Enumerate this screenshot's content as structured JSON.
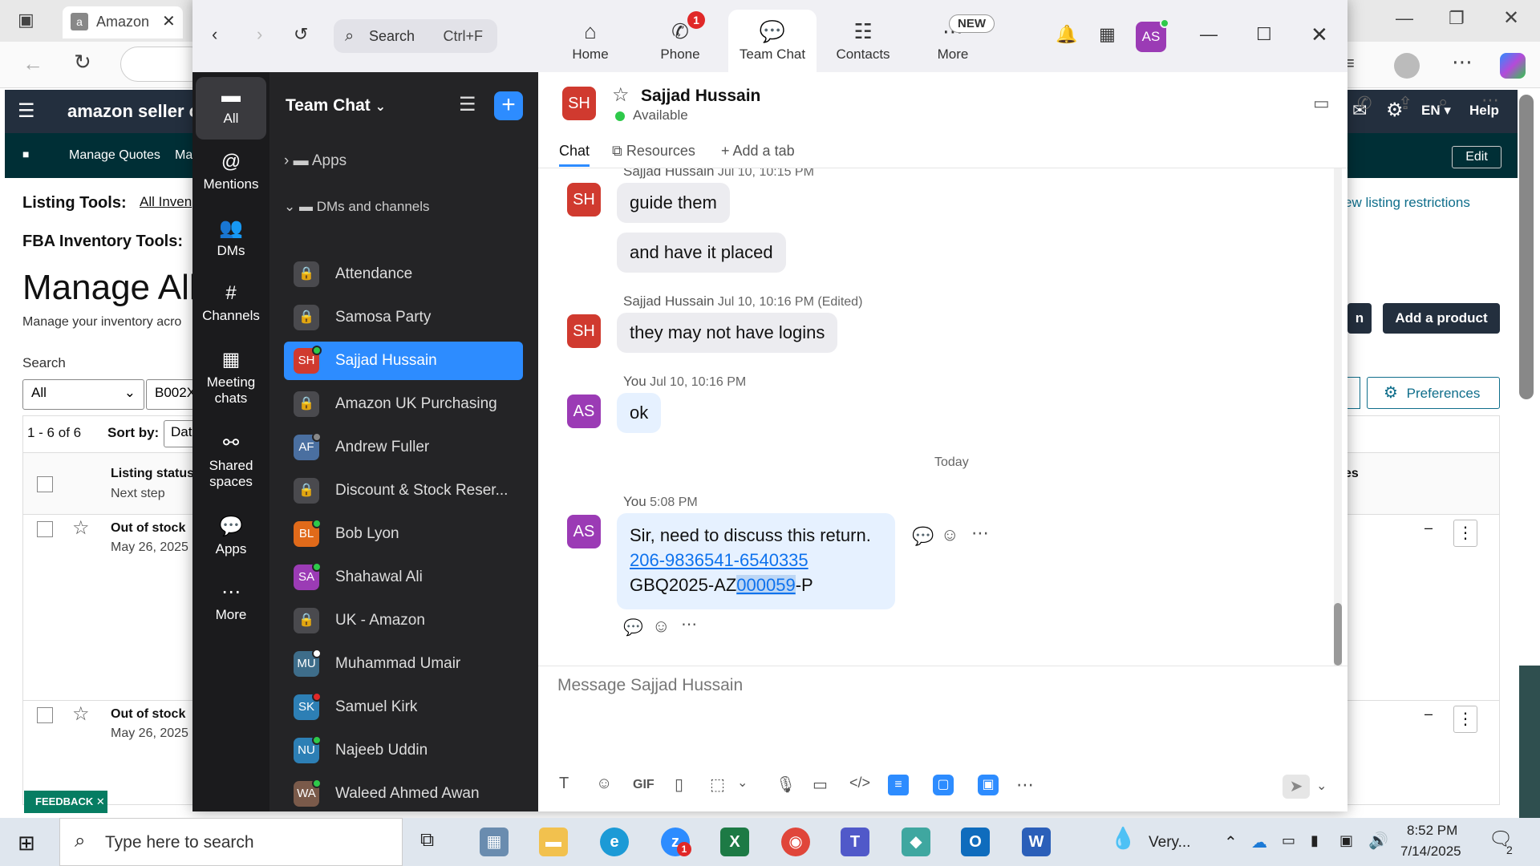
{
  "browser": {
    "tab_title": "Amazon"
  },
  "amazon": {
    "logo": "amazon seller central",
    "nav_items": [
      "Manage Quotes",
      "Ma"
    ],
    "top_right": {
      "lang": "EN",
      "help": "Help",
      "edit": "Edit"
    },
    "listing_tools_label": "Listing Tools:",
    "all_inventory_link": "All Inven",
    "fba_tools_label": "FBA Inventory Tools:",
    "heading": "Manage All",
    "subheading": "Manage your inventory acro",
    "view_restrictions": "ew listing restrictions",
    "add_product": "Add a product",
    "partial_btn": "n",
    "search_label": "Search",
    "filter_value": "All",
    "search_value": "B002X",
    "preferences": "Preferences",
    "results": "1 - 6 of 6",
    "sort_by": "Sort by:",
    "sort_value": "Dat",
    "col_status": "Listing status",
    "col_next": "Next step",
    "col_right": "es",
    "rows": [
      {
        "status": "Out of stock",
        "date": "May 26, 2025",
        "dash": "–"
      },
      {
        "status": "Out of stock",
        "date": "May 26, 2025",
        "dash": "–"
      }
    ],
    "feedback": "FEEDBACK"
  },
  "zoom": {
    "search_placeholder": "Search",
    "search_shortcut": "Ctrl+F",
    "tabs": [
      {
        "label": "Home",
        "icon": "home-icon"
      },
      {
        "label": "Phone",
        "icon": "phone-icon",
        "badge": "1"
      },
      {
        "label": "Team Chat",
        "icon": "chat-icon"
      },
      {
        "label": "Contacts",
        "icon": "contacts-icon"
      },
      {
        "label": "More",
        "icon": "more-icon",
        "badge": "NEW"
      }
    ],
    "user_initials": "AS",
    "rail": [
      {
        "label": "All"
      },
      {
        "label": "Mentions"
      },
      {
        "label": "DMs"
      },
      {
        "label": "Channels"
      },
      {
        "label": "Meeting chats"
      },
      {
        "label": "Shared spaces"
      },
      {
        "label": "Apps"
      },
      {
        "label": "More"
      }
    ],
    "panel": {
      "title": "Team Chat",
      "apps": "Apps",
      "dms_channels": "DMs and channels",
      "items": [
        {
          "name": "Attendance",
          "type": "lock"
        },
        {
          "name": "Samosa Party",
          "type": "lock"
        },
        {
          "name": "Sajjad Hussain",
          "initials": "SH",
          "color": "#d03a2f",
          "presence": "#2ec94a",
          "selected": true
        },
        {
          "name": "Amazon UK Purchasing",
          "type": "lock"
        },
        {
          "name": "Andrew Fuller",
          "initials": "AF",
          "color": "#4a6fa0",
          "presence": "#888888"
        },
        {
          "name": "Discount & Stock Reser...",
          "type": "lock"
        },
        {
          "name": "Bob Lyon",
          "initials": "BL",
          "color": "#e06a1a",
          "presence": "#2ec94a"
        },
        {
          "name": "Shahawal Ali",
          "initials": "SA",
          "color": "#9b3bb5",
          "presence": "#2ec94a"
        },
        {
          "name": "UK - Amazon",
          "type": "lock"
        },
        {
          "name": "Muhammad Umair",
          "initials": "MU",
          "color": "#3e6d8a",
          "presence": "#ffffff"
        },
        {
          "name": "Samuel Kirk",
          "initials": "SK",
          "color": "#2d7fb5",
          "presence": "#e02828"
        },
        {
          "name": "Najeeb Uddin",
          "initials": "NU",
          "color": "#2d7fb5",
          "presence": "#2ec94a"
        },
        {
          "name": "Waleed Ahmed Awan",
          "initials": "WA",
          "color": "#7a5a4a",
          "presence": "#2ec94a"
        }
      ]
    },
    "chat": {
      "contact_name": "Sajjad Hussain",
      "contact_initials": "SH",
      "status": "Available",
      "tabs": [
        "Chat",
        "Resources",
        "Add a tab"
      ],
      "messages": [
        {
          "sender": "Sajjad Hussain",
          "time": "Jul 10, 10:15 PM",
          "lines": [
            "guide them",
            "and have it placed"
          ]
        },
        {
          "sender": "Sajjad Hussain",
          "time": "Jul 10, 10:16 PM (Edited)",
          "lines": [
            "they may not have logins"
          ]
        },
        {
          "sender": "You",
          "time": "Jul 10, 10:16 PM",
          "lines": [
            "ok"
          ]
        }
      ],
      "divider": "Today",
      "last_message": {
        "sender": "You",
        "time": "5:08 PM",
        "line1": "Sir, need to discuss this return.",
        "link": "206-9836541-6540335",
        "line3_a": "GBQ2025-AZ",
        "line3_sel": "000059",
        "line3_b": "-P"
      },
      "composer_placeholder": "Message Sajjad Hussain"
    }
  },
  "taskbar": {
    "search_placeholder": "Type here to search",
    "weather": "Very...",
    "time": "8:52 PM",
    "date": "7/14/2025",
    "notif_count": "2",
    "zoom_badge": "1"
  }
}
